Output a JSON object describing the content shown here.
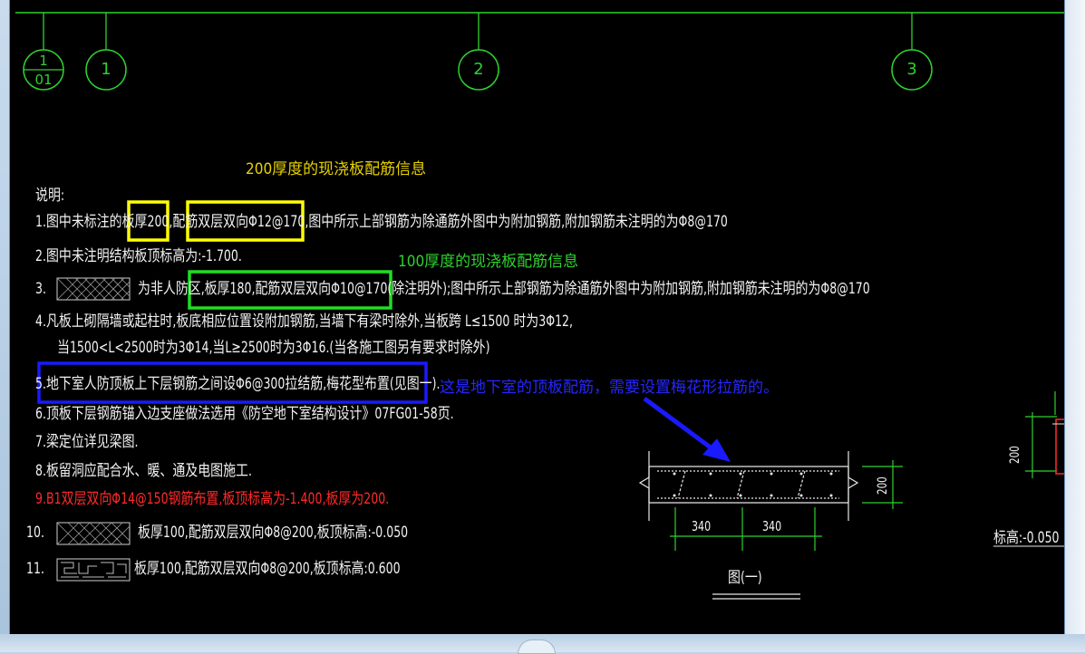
{
  "axes": {
    "bubble_small_top": "1",
    "bubble_small_bottom": "01",
    "bubble_1": "1",
    "bubble_2": "2",
    "bubble_3": "3"
  },
  "notes": {
    "title_200": "200厚度的现浇板配筋信息",
    "title_100": "100厚度的现浇板配筋信息",
    "heading": "说明:",
    "line1": "1.图中未标注的板厚200,配筋双层双向Φ12@170,图中所示上部钢筋为除通筋外图中为附加钢筋,附加钢筋未注明的为Φ8@170",
    "line2": "2.图中未注明结构板顶标高为:-1.700.",
    "line3_num": "3.",
    "line3": "为非人防区,板厚180,配筋双层双向Φ10@170(除注明外);图中所示上部钢筋为除通筋外图中为附加钢筋,附加钢筋未注明的为Φ8@170",
    "line4a": "4.凡板上砌隔墙或起柱时,板底相应位置设附加钢筋,当墙下有梁时除外,当板跨 L≤1500 时为3Φ12,",
    "line4b": "当1500<L<2500时为3Φ14,当L≥2500时为3Φ16.(当各施工图另有要求时除外)",
    "line5": "5.地下室人防顶板上下层钢筋之间设Φ6@300拉结筋,梅花型布置(见图一).",
    "line5_note": "这是地下室的顶板配筋，需要设置梅花形拉筋的。",
    "line6": "6.顶板下层钢筋锚入边支座做法选用《防空地下室结构设计》07FG01-58页.",
    "line7": "7.梁定位详见梁图.",
    "line8": "8.板留洞应配合水、暖、通及电图施工.",
    "line9": "9.B1双层双向Φ14@150钢筋布置,板顶标高为-1.400,板厚为200.",
    "line10_num": "10.",
    "line10": "板厚100,配筋双层双向Φ8@200,板顶标高:-0.050",
    "line11_num": "11.",
    "line11": "板厚100,配筋双层双向Φ8@200,板顶标高:0.600"
  },
  "detail": {
    "dim_left": "340",
    "dim_right": "340",
    "dim_height": "200",
    "caption": "图(一)",
    "side_dim": "200",
    "side_elev": "标高:-0.050"
  },
  "colors": {
    "cad_background": "#000000",
    "axis_green": "#2fd12f",
    "highlight_yellow": "#ffff00",
    "highlight_green": "#22dd22",
    "highlight_blue": "#1a1aff",
    "note_red": "#ff2a2a"
  }
}
